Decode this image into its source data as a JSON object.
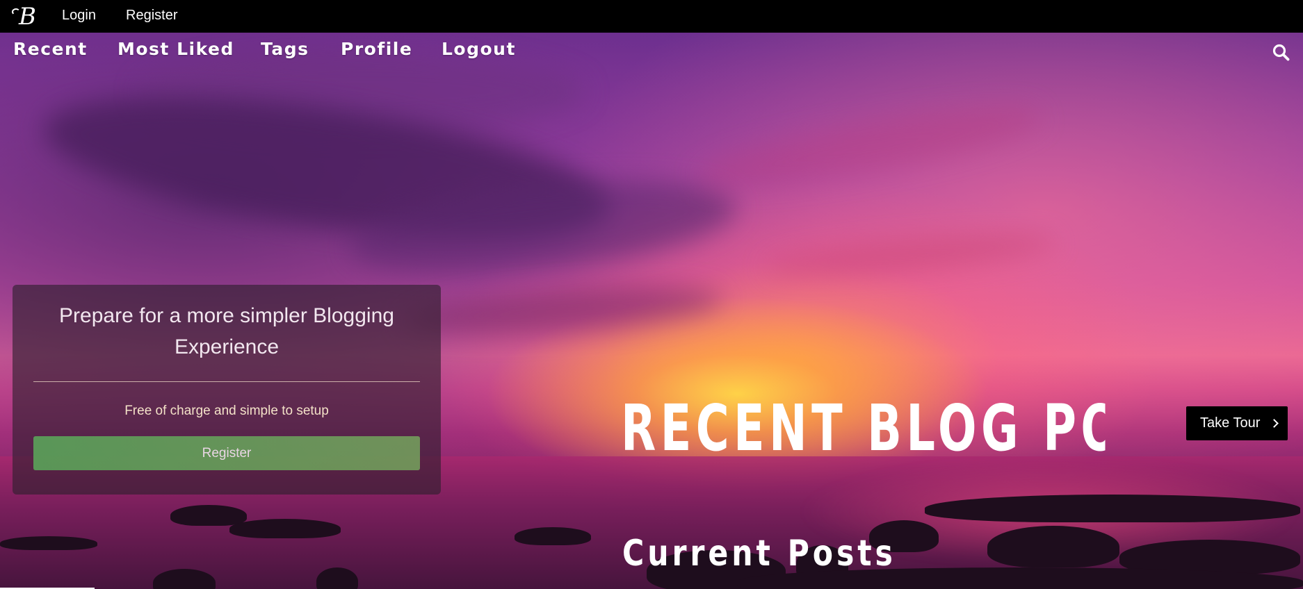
{
  "brand": {
    "logo_letter": "B"
  },
  "topbar": {
    "login_label": "Login",
    "register_label": "Register"
  },
  "nav": {
    "items": [
      {
        "label": "Recent"
      },
      {
        "label": "Most Liked"
      },
      {
        "label": "Tags"
      },
      {
        "label": "Profile"
      },
      {
        "label": "Logout"
      }
    ],
    "search_icon": "search-icon"
  },
  "signup_card": {
    "title": "Prepare for a more simpler Blogging Experience",
    "subtitle": "Free of charge and simple to setup",
    "button_label": "Register",
    "button_color": "#5aaa5a"
  },
  "hero": {
    "heading": "RECENT BLOG POSTS",
    "subheading": "Current Posts",
    "tour_label": "Take Tour",
    "tour_icon": "chevron-right-icon"
  }
}
